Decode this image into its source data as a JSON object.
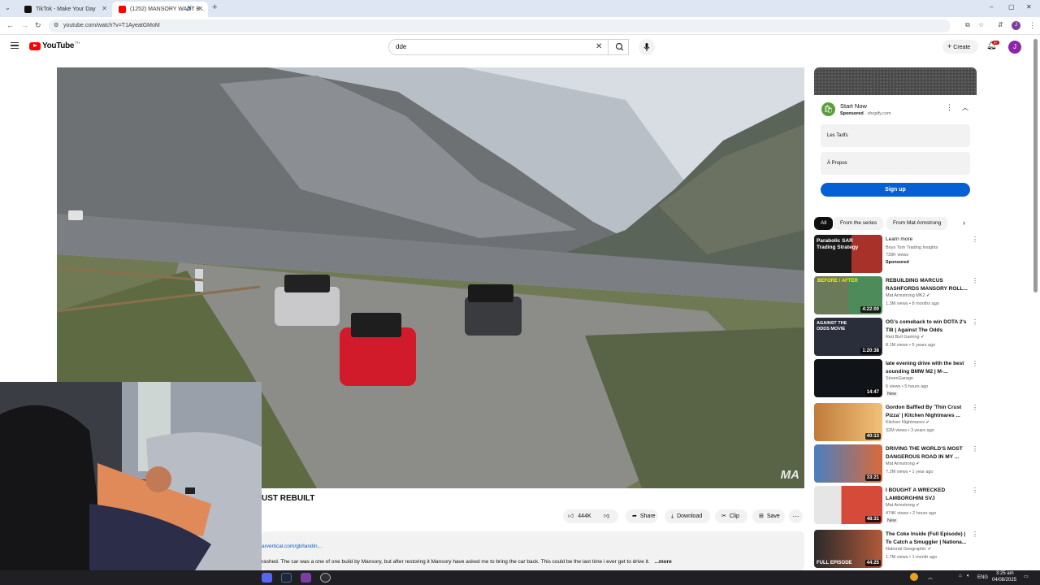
{
  "browser": {
    "tabs": [
      {
        "title": "TikTok - Make Your Day",
        "active": false
      },
      {
        "title": "(1252) MANSORY WANT B...",
        "active": true
      }
    ],
    "new_tab": "+",
    "url": "youtube.com/watch?v=T1AyeatGMoM",
    "window_controls": [
      "–",
      "▢",
      "✕"
    ],
    "profile_initial": "J"
  },
  "youtube": {
    "logo": "YouTube",
    "logo_sup": "TH",
    "search_value": "dde",
    "create_label": "Create",
    "notif_count": "9+",
    "avatar": "J"
  },
  "video": {
    "watermark": "MA",
    "title_visible": "UST REBUILT",
    "likes": "444K",
    "actions": {
      "share": "Share",
      "download": "Download",
      "clip": "Clip",
      "save": "Save"
    },
    "description_link": "arvertical.com/gb/landin...",
    "description_text": "rashed. The car was a one of one build by Mansory, but after restoring it Mansory have asked me to bring the car back. This could be the last time i ever get to drive it.",
    "more": "...more"
  },
  "ad": {
    "title": "Start Now",
    "sponsored": "Sponsored",
    "domain": "shopify.com",
    "links": [
      "Les Tarifs",
      "À Propos"
    ],
    "cta": "Sign up"
  },
  "chips": [
    "All",
    "From the series",
    "From Mat Armstrong"
  ],
  "sidebar_videos": [
    {
      "title": "Learn more",
      "channel": "Boys Tom Trading Insights",
      "meta": "739K views",
      "extra": "Sponsored",
      "duration": "",
      "thumb_text": "Parabolic SAR Trading Strategy",
      "verified": false
    },
    {
      "title": "REBUILDING MARCUS RASHFORDS MANSORY ROLL...",
      "channel": "Mat Armstrong MK2",
      "meta": "1.3M views • 8 months ago",
      "extra": "",
      "duration": "4:22:00",
      "thumb_text": "BEFORE / AFTER",
      "verified": true
    },
    {
      "title": "OG's comeback to win DOTA 2's TI8 | Against The Odds",
      "channel": "Red Bull Gaming",
      "meta": "8.1M views • 5 years ago",
      "extra": "",
      "duration": "1:20:38",
      "thumb_text": "AGAINST THE ODDS MOVIE",
      "verified": true
    },
    {
      "title": "late evening drive with the best sounding BMW M2 | M-...",
      "channel": "SirsenGarage",
      "meta": "6 views • 5 hours ago",
      "extra": "New",
      "duration": "14:47",
      "thumb_text": "",
      "verified": false
    },
    {
      "title": "Gordon Baffled By 'Thin Crust Pizza' | Kitchen Nightmares ...",
      "channel": "Kitchen Nightmares",
      "meta": "32M views • 3 years ago",
      "extra": "",
      "duration": "40:13",
      "thumb_text": "",
      "verified": true
    },
    {
      "title": "DRIVING THE WORLD'S MOST DANGEROUS ROAD IN MY ...",
      "channel": "Mat Armstrong",
      "meta": "7.2M views • 1 year ago",
      "extra": "",
      "duration": "33:21",
      "thumb_text": "",
      "verified": true
    },
    {
      "title": "I BOUGHT A WRECKED LAMBORGHINI SVJ",
      "channel": "Mat Armstrong",
      "meta": "474K views • 2 hours ago",
      "extra": "New",
      "duration": "48:31",
      "thumb_text": "",
      "verified": true
    },
    {
      "title": "The Coke Inside (Full Episode) | To Catch a Smuggler | Nationa...",
      "channel": "National Geographic",
      "meta": "1.7M views • 1 month ago",
      "extra": "",
      "duration": "44:25",
      "thumb_text": "FULL EPISODE",
      "verified": true
    }
  ],
  "taskbar": {
    "lang": "ENG",
    "time": "3:25 am",
    "date": "04/08/2025"
  },
  "colors": {
    "youtube_red": "#ff0000",
    "signup_blue": "#065fd4",
    "shopify_green": "#5a9e3a"
  }
}
